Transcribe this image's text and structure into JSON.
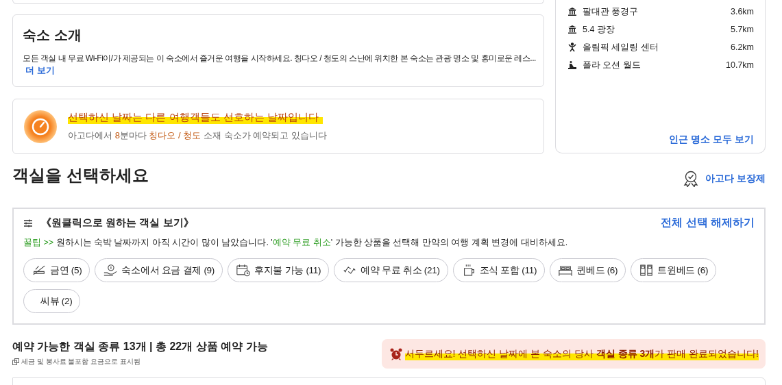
{
  "intro": {
    "title": "숙소 소개",
    "text": "모든 객실 내 무료 Wi-Fi이/가 제공되는 이 숙소에서 즐거운 여행을 시작하세요. 칭다오 / 청도의 스난에 위치한 본 숙소는 관광 명소 및 흥미로운 레스...",
    "more": "더 보기"
  },
  "popular": {
    "title": "선택하신 날짜는 다른 여행객들도 선호하는 날짜입니다",
    "segments": [
      {
        "text": "아고다에서 ",
        "kind": "plain"
      },
      {
        "text": "8",
        "kind": "accent"
      },
      {
        "text": "분마다 ",
        "kind": "plain"
      },
      {
        "text": "칭다오 / 청도",
        "kind": "accent"
      },
      {
        "text": " 소재 숙소가 예약되고 있습니다",
        "kind": "plain"
      }
    ]
  },
  "nearby": {
    "places": [
      {
        "name": "팔대관 풍경구",
        "distance": "3.6km",
        "kind": "museum"
      },
      {
        "name": "5.4 광장",
        "distance": "5.7km",
        "kind": "museum"
      },
      {
        "name": "올림픽 세일링 센터",
        "distance": "6.2km",
        "kind": "sport"
      },
      {
        "name": "폴라 오션 월드",
        "distance": "10.7km",
        "kind": "beach"
      }
    ],
    "link": "인근 명소 모두 보기"
  },
  "rooms": {
    "title": "객실을 선택하세요",
    "guarantee": "아고다 보장제"
  },
  "filters": {
    "title": "《원클릭으로 원하는 객실 보기》",
    "clear": "전체 선택 해제하기",
    "tip": [
      {
        "text": "꿀팁 >>",
        "kind": "accent"
      },
      {
        "text": " 원하시는 숙박 날짜까지 아직 시간이 많이 남았습니다. '",
        "kind": "plain"
      },
      {
        "text": "예약 무료 취소",
        "kind": "accent"
      },
      {
        "text": "' 가능한 상품을 선택해 만약의 여행 계획 변경에 대비하세요.",
        "kind": "plain"
      }
    ],
    "options": [
      {
        "label": "금연 (5)",
        "kind": "no-smoking"
      },
      {
        "label": "숙소에서 요금 결제 (9)",
        "kind": "pay-hotel"
      },
      {
        "label": "후지불 가능 (11)",
        "kind": "pay-later"
      },
      {
        "label": "예약 무료 취소 (21)",
        "kind": "free-cancel"
      },
      {
        "label": "조식 포함 (11)",
        "kind": "breakfast"
      },
      {
        "label": "퀸베드 (6)",
        "kind": "queen"
      },
      {
        "label": "트윈베드 (6)",
        "kind": "twin"
      },
      {
        "label": "씨뷰 (2)",
        "kind": "none"
      }
    ]
  },
  "availability": {
    "title": "예약 가능한 객실 종류 13개 | 총 22개 상품 예약 가능",
    "note": "세금 및 봉사료 불포함 요금으로 표시됨"
  },
  "alert": {
    "text": "서두르세요! 선택하신 날짜에 본 숙소의 당사 **객실 종류 3개**가 판매 완료되었습니다!"
  }
}
